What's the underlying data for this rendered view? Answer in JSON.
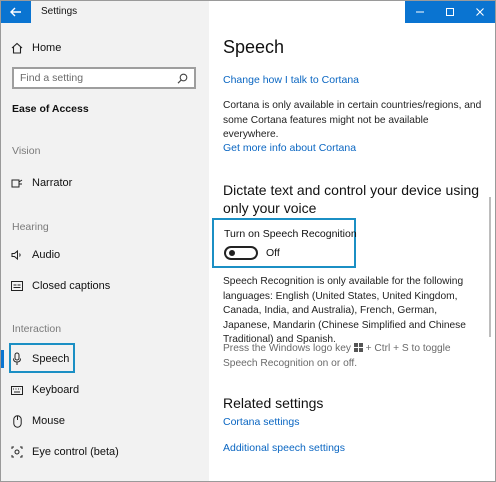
{
  "window": {
    "title": "Settings"
  },
  "sidebar": {
    "home": "Home",
    "search_placeholder": "Find a setting",
    "category": "Ease of Access",
    "groups": [
      {
        "label": "Vision",
        "items": [
          {
            "label": "Narrator",
            "icon": "narrator-icon"
          }
        ]
      },
      {
        "label": "Hearing",
        "items": [
          {
            "label": "Audio",
            "icon": "speaker-icon"
          },
          {
            "label": "Closed captions",
            "icon": "closed-captions-icon"
          }
        ]
      },
      {
        "label": "Interaction",
        "items": [
          {
            "label": "Speech",
            "icon": "microphone-icon",
            "selected": true
          },
          {
            "label": "Keyboard",
            "icon": "keyboard-icon"
          },
          {
            "label": "Mouse",
            "icon": "mouse-icon"
          },
          {
            "label": "Eye control (beta)",
            "icon": "eye-icon"
          }
        ]
      }
    ]
  },
  "main": {
    "title": "Speech",
    "cortana_link": "Change how I talk to Cortana",
    "cortana_note": "Cortana is only available in certain countries/regions, and some Cortana features might not be available everywhere.",
    "cortana_info_link": "Get more info about Cortana",
    "dictate_heading": "Dictate text and control your device using only your voice",
    "toggle_label": "Turn on Speech Recognition",
    "toggle_state": "Off",
    "recognition_note": "Speech Recognition is only available for the following languages: English (United States, United Kingdom, Canada, India, and Australia), French, German, Japanese, Mandarin (Chinese Simplified and Chinese Traditional) and Spanish.",
    "shortcut_prefix": "Press the Windows logo key",
    "shortcut_suffix": "+ Ctrl + S to toggle Speech Recognition on or off.",
    "related_heading": "Related settings",
    "related_links": [
      "Cortana settings",
      "Additional speech settings"
    ]
  },
  "colors": {
    "accent": "#0a74d1",
    "highlight_border": "#1b8fc4",
    "link": "#0a66c2",
    "sidebar_bg": "#f2f2f2"
  }
}
